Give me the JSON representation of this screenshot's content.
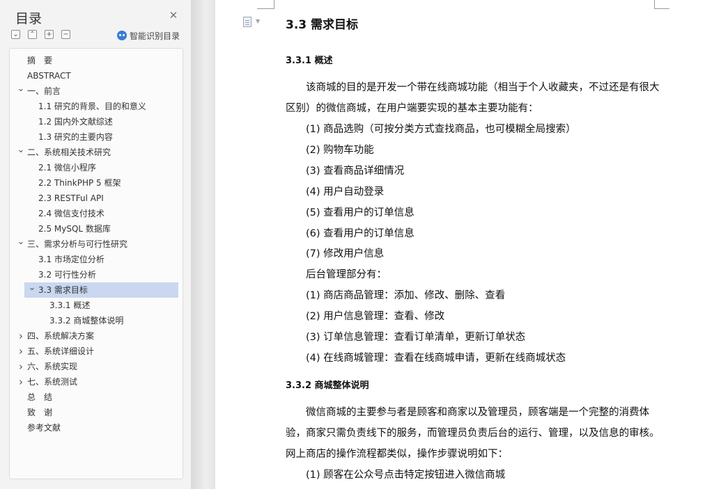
{
  "sidebar": {
    "title": "目录",
    "close_icon": "close-icon",
    "toolbar": {
      "collapse_icon": "chevron-down-icon",
      "up_icon": "chevron-up-icon",
      "plus_icon": "plus-icon",
      "minus_icon": "minus-icon",
      "smart_toc_label": "智能识别目录"
    },
    "toc": [
      {
        "label": "摘　要",
        "level": 0,
        "expander": "none"
      },
      {
        "label": "ABSTRACT",
        "level": 0,
        "expander": "none"
      },
      {
        "label": "一、前言",
        "level": 0,
        "expander": "expanded"
      },
      {
        "label": "1.1  研究的背景、目的和意义",
        "level": 1,
        "expander": "none"
      },
      {
        "label": "1.2  国内外文献综述",
        "level": 1,
        "expander": "none"
      },
      {
        "label": "1.3  研究的主要内容",
        "level": 1,
        "expander": "none"
      },
      {
        "label": "二、系统相关技术研究",
        "level": 0,
        "expander": "expanded"
      },
      {
        "label": "2.1  微信小程序",
        "level": 1,
        "expander": "none"
      },
      {
        "label": "2.2 ThinkPHP 5  框架",
        "level": 1,
        "expander": "none"
      },
      {
        "label": "2.3 RESTFul API",
        "level": 1,
        "expander": "none"
      },
      {
        "label": "2.4  微信支付技术",
        "level": 1,
        "expander": "none"
      },
      {
        "label": "2.5 MySQL 数据库",
        "level": 1,
        "expander": "none"
      },
      {
        "label": "三、需求分析与可行性研究",
        "level": 0,
        "expander": "expanded"
      },
      {
        "label": "3.1  市场定位分析",
        "level": 1,
        "expander": "none"
      },
      {
        "label": "3.2  可行性分析",
        "level": 1,
        "expander": "none"
      },
      {
        "label": "3.3  需求目标",
        "level": 1,
        "expander": "expanded",
        "selected": true
      },
      {
        "label": "3.3.1  概述",
        "level": 2,
        "expander": "none"
      },
      {
        "label": "3.3.2  商城整体说明",
        "level": 2,
        "expander": "none"
      },
      {
        "label": "四、系统解决方案",
        "level": 0,
        "expander": "collapsed"
      },
      {
        "label": "五、系统详细设计",
        "level": 0,
        "expander": "collapsed"
      },
      {
        "label": "六、系统实现",
        "level": 0,
        "expander": "collapsed"
      },
      {
        "label": "七、系统测试",
        "level": 0,
        "expander": "collapsed"
      },
      {
        "label": "总　结",
        "level": 0,
        "expander": "none"
      },
      {
        "label": "致　谢",
        "level": 0,
        "expander": "none"
      },
      {
        "label": "参考文献",
        "level": 0,
        "expander": "none"
      }
    ]
  },
  "document": {
    "heading": "3.3  需求目标",
    "sub1": "3.3.1  概述",
    "p1_line1": "该商城的目的是开发一个带在线商城功能（相当于个人收藏夹，不过还是有很大",
    "p1_line2": "区别）的微信商城，在用户端要实现的基本主要功能有：",
    "user_items": [
      "(1)  商品选购（可按分类方式查找商品，也可模糊全局搜索）",
      "(2)  购物车功能",
      "(3)  查看商品详细情况",
      "(4)  用户自动登录",
      "(5)  查看用户的订单信息",
      "(6)  查看用户的订单信息",
      "(7)  修改用户信息"
    ],
    "admin_intro": "后台管理部分有：",
    "admin_items": [
      "(1)  商店商品管理：添加、修改、删除、查看",
      "(2)  用户信息管理：查看、修改",
      "(3)  订单信息管理：查看订单清单，更新订单状态",
      "(4)  在线商城管理：查看在线商城申请，更新在线商城状态"
    ],
    "sub2": "3.3.2  商城整体说明",
    "p2_line1": "微信商城的主要参与者是顾客和商家以及管理员，顾客端是一个完整的消费体",
    "p2_line2": "验，商家只需负责线下的服务，而管理员负责后台的运行、管理，以及信息的审核。",
    "p2_line3": "网上商店的操作流程都类似，操作步骤说明如下：",
    "step1": "(1)  顾客在公众号点击特定按钮进入微信商城",
    "doc_icon": "document-icon"
  }
}
